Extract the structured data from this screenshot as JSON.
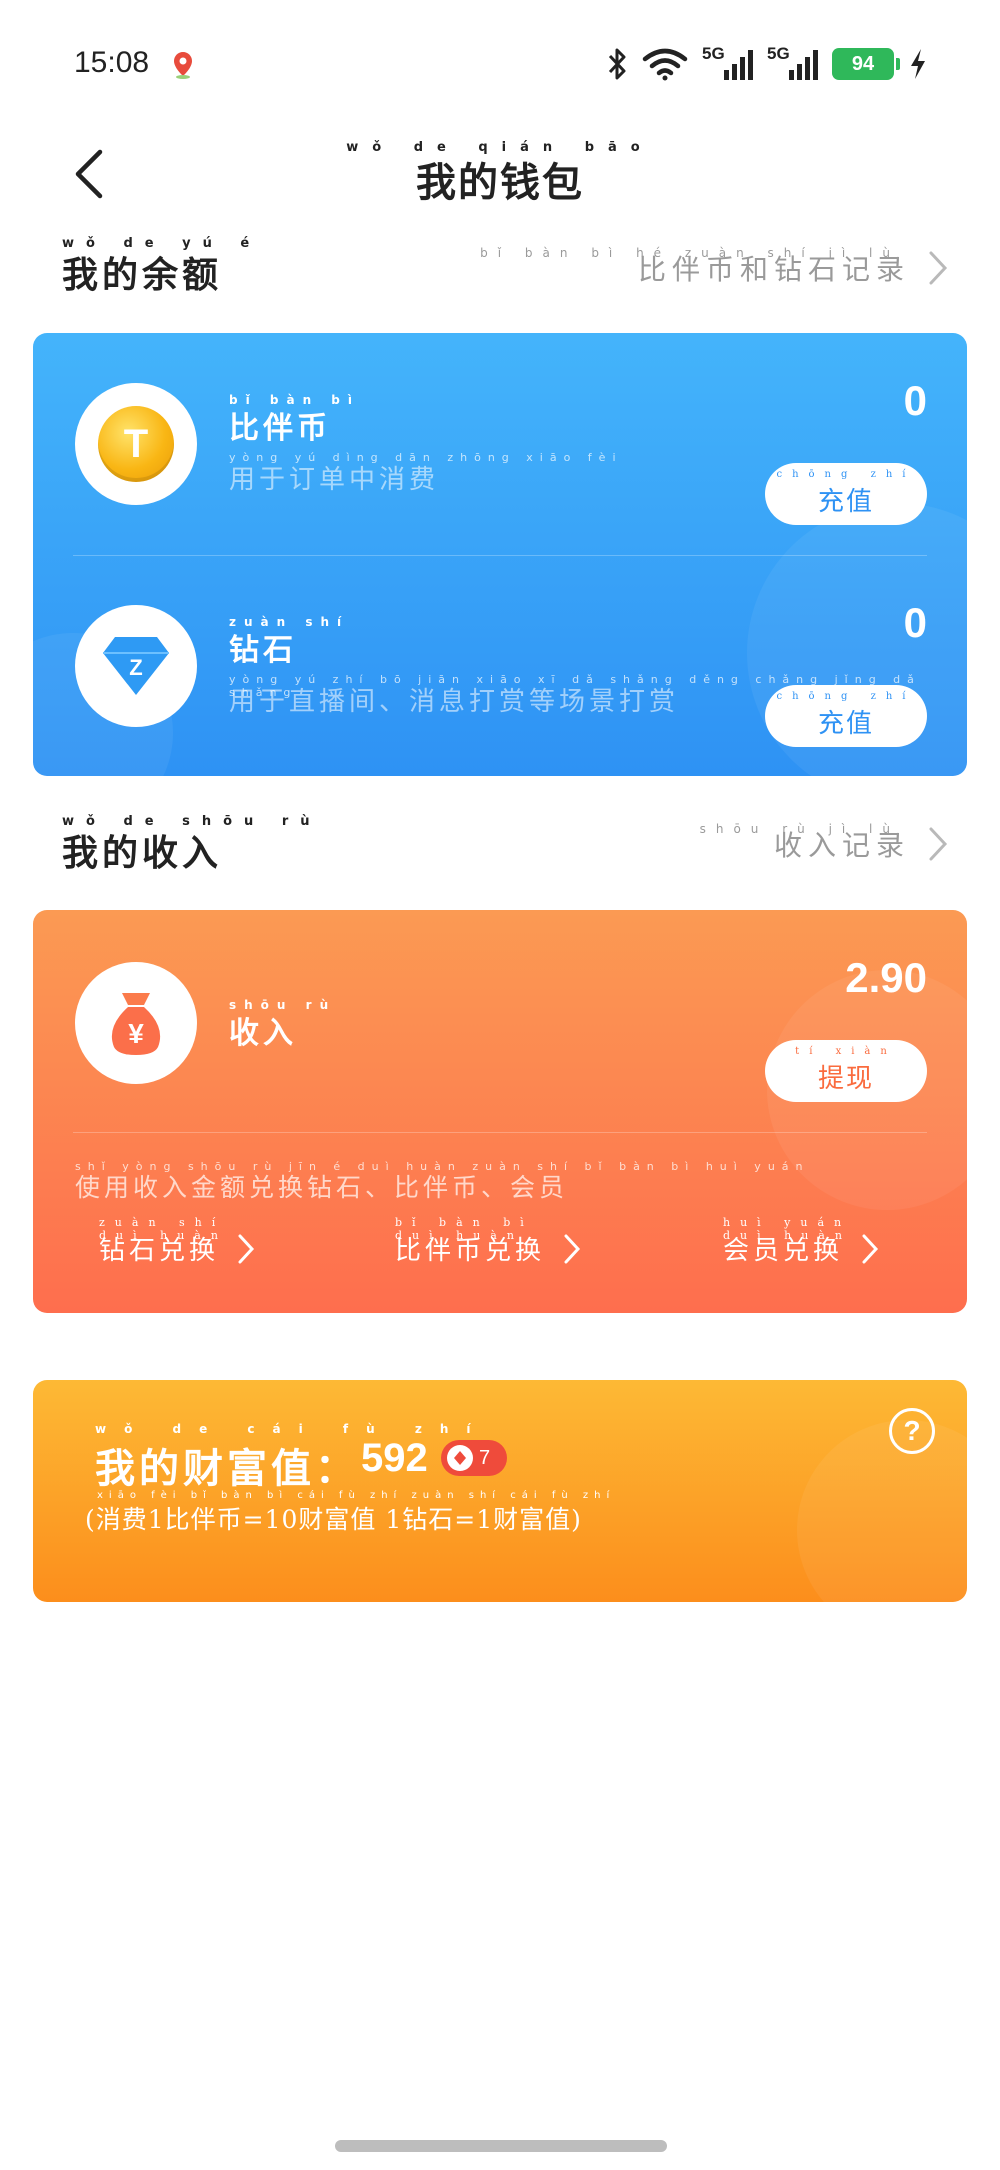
{
  "status": {
    "time": "15:08",
    "network1": "5G",
    "network2": "5G",
    "battery": "94"
  },
  "header": {
    "title": "我的钱包",
    "title_pinyin": "wǒ de qián bāo"
  },
  "balance_section": {
    "title": "我的余额",
    "title_pinyin": "wǒ de yú é",
    "link": "比伴币和钻石记录",
    "link_pinyin": "bǐ bàn bì hé zuàn shí jì lù"
  },
  "coin": {
    "icon_letter": "T",
    "name": "比伴币",
    "name_pinyin": "bǐ bàn bì",
    "desc": "用于订单中消费",
    "desc_pinyin": "yòng yú dìng dān zhōng xiāo fèi",
    "amount": "0",
    "button": "充值",
    "button_pinyin": "chōng zhí"
  },
  "diamond": {
    "icon_letter": "Z",
    "name": "钻石",
    "name_pinyin": "zuàn shí",
    "desc": "用于直播间、消息打赏等场景打赏",
    "desc_pinyin": "yòng yú zhí bō jiān xiāo xī dǎ shǎng děng chǎng jǐng dǎ shǎng",
    "amount": "0",
    "button": "充值",
    "button_pinyin": "chōng zhí"
  },
  "income_section": {
    "title": "我的收入",
    "title_pinyin": "wǒ de shōu rù",
    "link": "收入记录",
    "link_pinyin": "shōu rù jì lù"
  },
  "income": {
    "icon_symbol": "¥",
    "name": "收入",
    "name_pinyin": "shōu rù",
    "amount": "2.90",
    "button": "提现",
    "button_pinyin": "tí xiàn",
    "desc": "使用收入金额兑换钻石、比伴币、会员",
    "desc_pinyin": "shǐ yòng shōu rù jīn é duì huàn zuàn shí bǐ bàn bì huì yuán",
    "exchanges": [
      {
        "label": "钻石兑换",
        "pinyin": "zuàn shí duì huàn"
      },
      {
        "label": "比伴币兑换",
        "pinyin": "bǐ bàn bì duì huàn"
      },
      {
        "label": "会员兑换",
        "pinyin": "huì yuán duì huàn"
      }
    ]
  },
  "wealth": {
    "title": "我的财富值：",
    "title_pinyin": "wǒ de cái fù zhí",
    "value": "592",
    "level": "7",
    "note": "(消费1比伴币=10财富值 1钻石=1财富值)",
    "note_pinyin": "xiāo fèi bǐ bàn bì cái fù zhí zuàn shí cái fù zhí",
    "help_symbol": "?"
  },
  "colors": {
    "blue": "#2e92f4",
    "orange": "#fe6e4e",
    "gold": "#fc8e1c",
    "battery": "#2fb85a"
  }
}
